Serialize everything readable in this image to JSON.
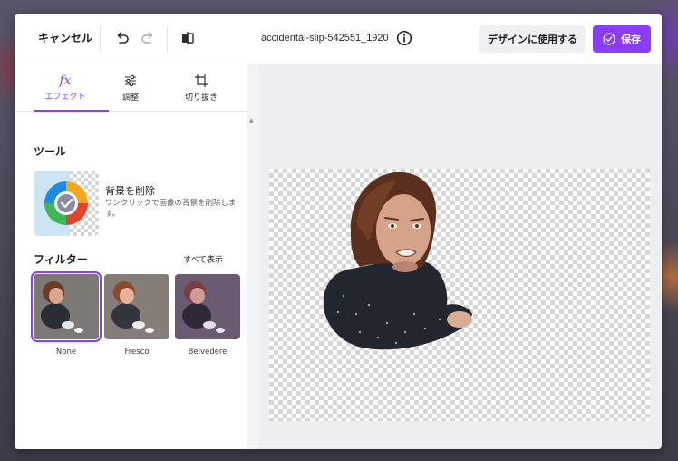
{
  "topbar": {
    "cancel_label": "キャンセル",
    "filename": "accidental-slip-542551_1920",
    "use_in_design_label": "デザインに使用する",
    "save_label": "保存",
    "accent_color": "#8b3dff"
  },
  "tabs": [
    {
      "label": "エフェクト",
      "icon": "fx-icon",
      "active": true
    },
    {
      "label": "調整",
      "icon": "sliders-icon",
      "active": false
    },
    {
      "label": "切り抜き",
      "icon": "crop-icon",
      "active": false
    }
  ],
  "tools": {
    "section_title": "ツール",
    "bg_remove": {
      "title": "背景を削除",
      "description": "ワンクリックで画像の背景を削除します。"
    }
  },
  "filters": {
    "section_title": "フィルター",
    "see_all_label": "すべて表示",
    "items": [
      {
        "name": "None",
        "selected": true
      },
      {
        "name": "Fresco",
        "selected": false
      },
      {
        "name": "Belvedere",
        "selected": false
      }
    ]
  }
}
